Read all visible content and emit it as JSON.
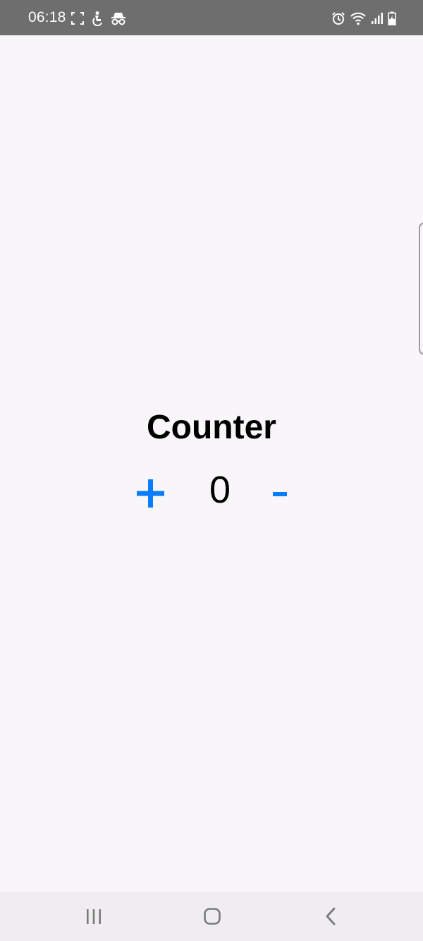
{
  "status_bar": {
    "time": "06:18",
    "left_icons": [
      "screenshot-frame-icon",
      "accessibility-person-icon",
      "incognito-icon"
    ],
    "right_icons": [
      "alarm-icon",
      "wifi-icon",
      "signal-icon",
      "battery-charging-icon"
    ],
    "background_color": "#6e6e6e"
  },
  "counter": {
    "title": "Counter",
    "increment_label": "+",
    "value": "0",
    "decrement_label": "-",
    "accent_color": "#0a7cff"
  },
  "nav_bar": {
    "icons": [
      "recent-apps-icon",
      "home-icon",
      "back-icon"
    ]
  }
}
